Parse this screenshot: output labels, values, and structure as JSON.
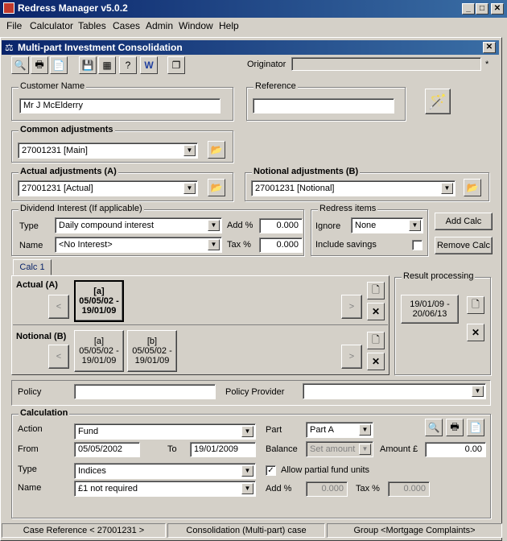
{
  "window": {
    "title": "Redress Manager v5.0.2"
  },
  "menu": [
    "File",
    "Calculator",
    "Tables",
    "Cases",
    "Admin",
    "Window",
    "Help"
  ],
  "child": {
    "title": "Multi-part Investment Consolidation"
  },
  "toolbar": {
    "originator_label": "Originator",
    "originator_value": "",
    "required_mark": "*"
  },
  "customer": {
    "label": "Customer Name",
    "value": "Mr J McElderry"
  },
  "reference": {
    "label": "Reference",
    "value": ""
  },
  "common_adj": {
    "label": "Common adjustments",
    "value": "27001231 [Main]"
  },
  "actual_adj": {
    "label": "Actual adjustments (A)",
    "value": "27001231 [Actual]"
  },
  "notional_adj": {
    "label": "Notional adjustments (B)",
    "value": "27001231 [Notional]"
  },
  "dividend": {
    "label": "Dividend Interest (If applicable)",
    "type_label": "Type",
    "type_value": "Daily compound interest",
    "name_label": "Name",
    "name_value": "<No Interest>",
    "add_label": "Add %",
    "add_value": "0.000",
    "tax_label": "Tax %",
    "tax_value": "0.000"
  },
  "redress": {
    "label": "Redress items",
    "ignore_label": "Ignore",
    "ignore_value": "None",
    "savings_label": "Include savings"
  },
  "buttons": {
    "add_calc": "Add Calc",
    "remove_calc": "Remove Calc"
  },
  "calc_tab": "Calc 1",
  "actual_row": {
    "label": "Actual (A)",
    "item_tag": "[a]",
    "item_range": "05/05/02 -\n19/01/09"
  },
  "notional_row": {
    "label": "Notional (B)",
    "items": [
      {
        "tag": "[a]",
        "range": "05/05/02 -\n19/01/09"
      },
      {
        "tag": "[b]",
        "range": "05/05/02 -\n19/01/09"
      }
    ]
  },
  "nav": {
    "prev": "<",
    "next": ">"
  },
  "result": {
    "label": "Result processing",
    "range": "19/01/09 -\n20/06/13"
  },
  "policy": {
    "label": "Policy",
    "value": "",
    "provider_label": "Policy Provider",
    "provider_value": ""
  },
  "calculation": {
    "label": "Calculation",
    "action_label": "Action",
    "action_value": "Fund",
    "from_label": "From",
    "from_value": "05/05/2002",
    "to_label": "To",
    "to_value": "19/01/2009",
    "type_label": "Type",
    "type_value": "Indices",
    "name_label": "Name",
    "name_value": "£1 not required",
    "part_label": "Part",
    "part_value": "Part A",
    "balance_label": "Balance",
    "balance_value": "Set amount",
    "amount_label": "Amount £",
    "amount_value": "0.00",
    "partial_label": "Allow partial fund units",
    "add_label": "Add %",
    "add_value": "0.000",
    "tax_label": "Tax %",
    "tax_value": "0.000"
  },
  "status": {
    "case_ref": "Case Reference < 27001231 >",
    "type": "Consolidation (Multi-part) case",
    "group": "Group <Mortgage Complaints>"
  }
}
